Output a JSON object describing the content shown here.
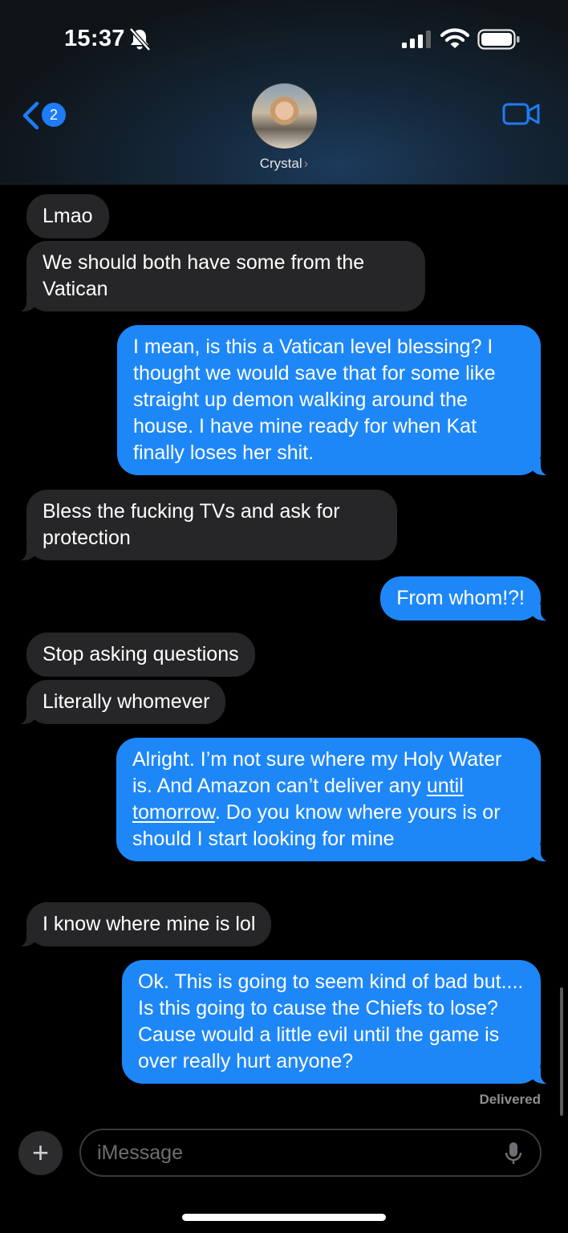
{
  "status": {
    "time": "15:37"
  },
  "header": {
    "back_badge": "2",
    "contact_name": "Crystal",
    "contact_chevron": "›"
  },
  "messages": [
    {
      "dir": "received",
      "text": "Lmao"
    },
    {
      "dir": "received",
      "text": "We should both have some from the Vatican"
    },
    {
      "dir": "sent",
      "text": "I mean, is this a Vatican level blessing? I thought we would save that for some like straight up demon walking around the house. I have mine ready for when Kat finally loses her shit."
    },
    {
      "dir": "received",
      "text": "Bless the fucking TVs and ask for protection"
    },
    {
      "dir": "sent",
      "text": "From whom!?!"
    },
    {
      "dir": "received",
      "text": "Stop asking questions"
    },
    {
      "dir": "received",
      "text": "Literally whomever"
    },
    {
      "dir": "sent",
      "text_before": "Alright. I’m not sure where my Holy Water is. And Amazon can’t deliver any",
      "link": "until tomorrow",
      "text_after": ". Do you know where yours is or should I start looking for mine"
    },
    {
      "dir": "received",
      "text": "I know where mine is lol"
    },
    {
      "dir": "sent",
      "text": "Ok. This is going to seem kind of bad but.... Is this going to cause the Chiefs to lose? Cause would a little evil until the game is over really hurt anyone?"
    }
  ],
  "delivered_label": "Delivered",
  "composer": {
    "placeholder": "iMessage",
    "plus": "+"
  },
  "colors": {
    "sent_bubble": "#1e87f7",
    "received_bubble": "#262628",
    "accent": "#1e7cf4"
  },
  "icons": [
    "bell-off-icon",
    "signal-icon",
    "wifi-icon",
    "battery-icon",
    "back-chevron-icon",
    "video-camera-icon",
    "plus-icon",
    "microphone-icon"
  ]
}
